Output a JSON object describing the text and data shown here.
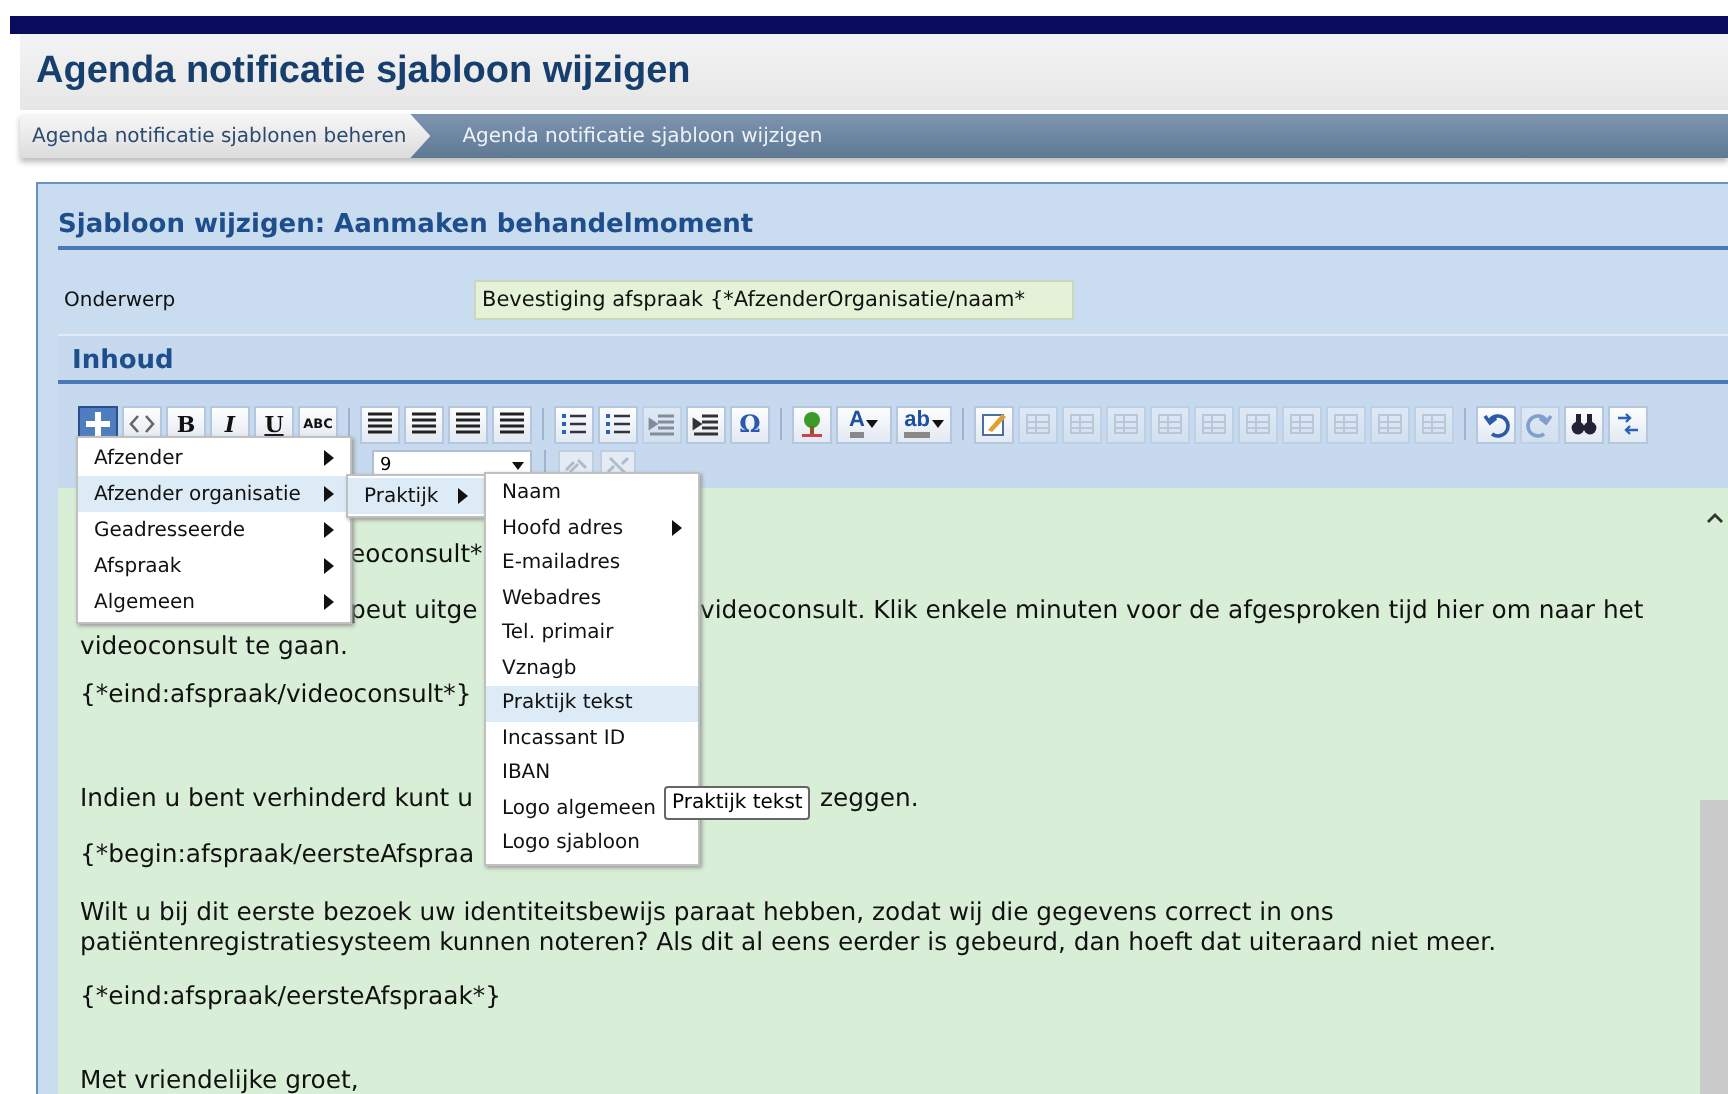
{
  "page_title": "Agenda notificatie sjabloon wijzigen",
  "breadcrumbs": [
    {
      "label": "Agenda notificatie sjablonen beheren",
      "selected": false
    },
    {
      "label": "Agenda notificatie sjabloon wijzigen",
      "selected": true
    }
  ],
  "panel": {
    "title": "Sjabloon wijzigen: Aanmaken behandelmoment",
    "subject": {
      "label": "Onderwerp",
      "value": "Bevestiging afspraak {*AfzenderOrganisatie/naam*"
    },
    "content_heading": "Inhoud",
    "toolbar": {
      "items": [
        {
          "kind": "insert",
          "selected": true,
          "disabled": false
        },
        {
          "kind": "source",
          "selected": false,
          "disabled": false
        },
        {
          "kind": "text",
          "label": "B",
          "selected": false,
          "disabled": false
        },
        {
          "kind": "text",
          "label": "I",
          "selected": false,
          "disabled": false
        },
        {
          "kind": "text",
          "label": "U",
          "selected": false,
          "disabled": false
        },
        {
          "kind": "text",
          "label": "ABC",
          "selected": false,
          "disabled": false
        },
        {
          "kind": "sep"
        },
        {
          "kind": "align-left",
          "selected": false,
          "disabled": false
        },
        {
          "kind": "align-center",
          "selected": false,
          "disabled": false
        },
        {
          "kind": "align-right",
          "selected": false,
          "disabled": false
        },
        {
          "kind": "align-justify",
          "selected": false,
          "disabled": false
        },
        {
          "kind": "sep"
        },
        {
          "kind": "bullets",
          "selected": false,
          "disabled": false
        },
        {
          "kind": "numbers",
          "selected": false,
          "disabled": false
        },
        {
          "kind": "outdent",
          "selected": false,
          "disabled": true
        },
        {
          "kind": "indent",
          "selected": false,
          "disabled": false
        },
        {
          "kind": "text",
          "label": "Ω",
          "selected": false,
          "disabled": false
        },
        {
          "kind": "sep"
        },
        {
          "kind": "image",
          "selected": false,
          "disabled": false
        },
        {
          "kind": "color",
          "label": "A",
          "selected": false,
          "disabled": false
        },
        {
          "kind": "color",
          "label": "ab",
          "selected": false,
          "disabled": false
        },
        {
          "kind": "sep"
        },
        {
          "kind": "edit",
          "selected": false,
          "disabled": false
        },
        {
          "kind": "table",
          "selected": false,
          "disabled": true
        },
        {
          "kind": "table",
          "selected": false,
          "disabled": true
        },
        {
          "kind": "table",
          "selected": false,
          "disabled": true
        },
        {
          "kind": "table",
          "selected": false,
          "disabled": true
        },
        {
          "kind": "table",
          "selected": false,
          "disabled": true
        },
        {
          "kind": "table",
          "selected": false,
          "disabled": true
        },
        {
          "kind": "table",
          "selected": false,
          "disabled": true
        },
        {
          "kind": "table",
          "selected": false,
          "disabled": true
        },
        {
          "kind": "table",
          "selected": false,
          "disabled": true
        },
        {
          "kind": "table",
          "selected": false,
          "disabled": true
        },
        {
          "kind": "sep"
        },
        {
          "kind": "undo",
          "selected": false,
          "disabled": false
        },
        {
          "kind": "redo",
          "selected": false,
          "disabled": true
        },
        {
          "kind": "find",
          "selected": false,
          "disabled": false
        },
        {
          "kind": "replace",
          "selected": false,
          "disabled": false
        }
      ]
    },
    "font_size": "9",
    "editor_lines": [
      [
        "eoconsult*"
      ],
      [
        "peut uitge",
        "videoconsult. Klik enkele minuten voor de afgesproken tijd hier om naar het"
      ],
      [
        "videoconsult te gaan."
      ],
      [
        "{*eind:afspraak/videoconsult*}"
      ],
      [
        "Indien u bent verhinderd kunt u",
        "zeggen."
      ],
      [
        "{*begin:afspraak/eersteAfspraa"
      ],
      [
        "Wilt u bij dit eerste bezoek uw identiteitsbewijs paraat hebben, zodat wij die gegevens correct in ons"
      ],
      [
        "patiëntenregistratiesysteem kunnen noteren? Als dit al eens eerder is gebeurd, dan hoeft dat uiteraard niet meer."
      ],
      [
        "{*eind:afspraak/eersteAfspraak*}"
      ],
      [
        "Met vriendelijke groet,"
      ]
    ]
  },
  "menus": [
    {
      "items": [
        {
          "label": "Afzender",
          "has_submenu": true,
          "selected": false
        },
        {
          "label": "Afzender organisatie",
          "has_submenu": true,
          "selected": true
        },
        {
          "label": "Geadresseerde",
          "has_submenu": true,
          "selected": false
        },
        {
          "label": "Afspraak",
          "has_submenu": true,
          "selected": false
        },
        {
          "label": "Algemeen",
          "has_submenu": true,
          "selected": false
        }
      ]
    },
    {
      "items": [
        {
          "label": "Praktijk",
          "has_submenu": true,
          "selected": true
        }
      ]
    },
    {
      "items": [
        {
          "label": "Naam",
          "has_submenu": false,
          "selected": false
        },
        {
          "label": "Hoofd adres",
          "has_submenu": true,
          "selected": false
        },
        {
          "label": "E-mailadres",
          "has_submenu": false,
          "selected": false
        },
        {
          "label": "Webadres",
          "has_submenu": false,
          "selected": false
        },
        {
          "label": "Tel. primair",
          "has_submenu": false,
          "selected": false
        },
        {
          "label": "Vznagb",
          "has_submenu": false,
          "selected": false
        },
        {
          "label": "Praktijk tekst",
          "has_submenu": false,
          "selected": true
        },
        {
          "label": "Incassant ID",
          "has_submenu": false,
          "selected": false
        },
        {
          "label": "IBAN",
          "has_submenu": false,
          "selected": false
        },
        {
          "label": "Logo algemeen",
          "has_submenu": false,
          "selected": false
        },
        {
          "label": "Logo sjabloon",
          "has_submenu": false,
          "selected": false
        }
      ]
    }
  ],
  "tooltip": "Praktijk tekst"
}
